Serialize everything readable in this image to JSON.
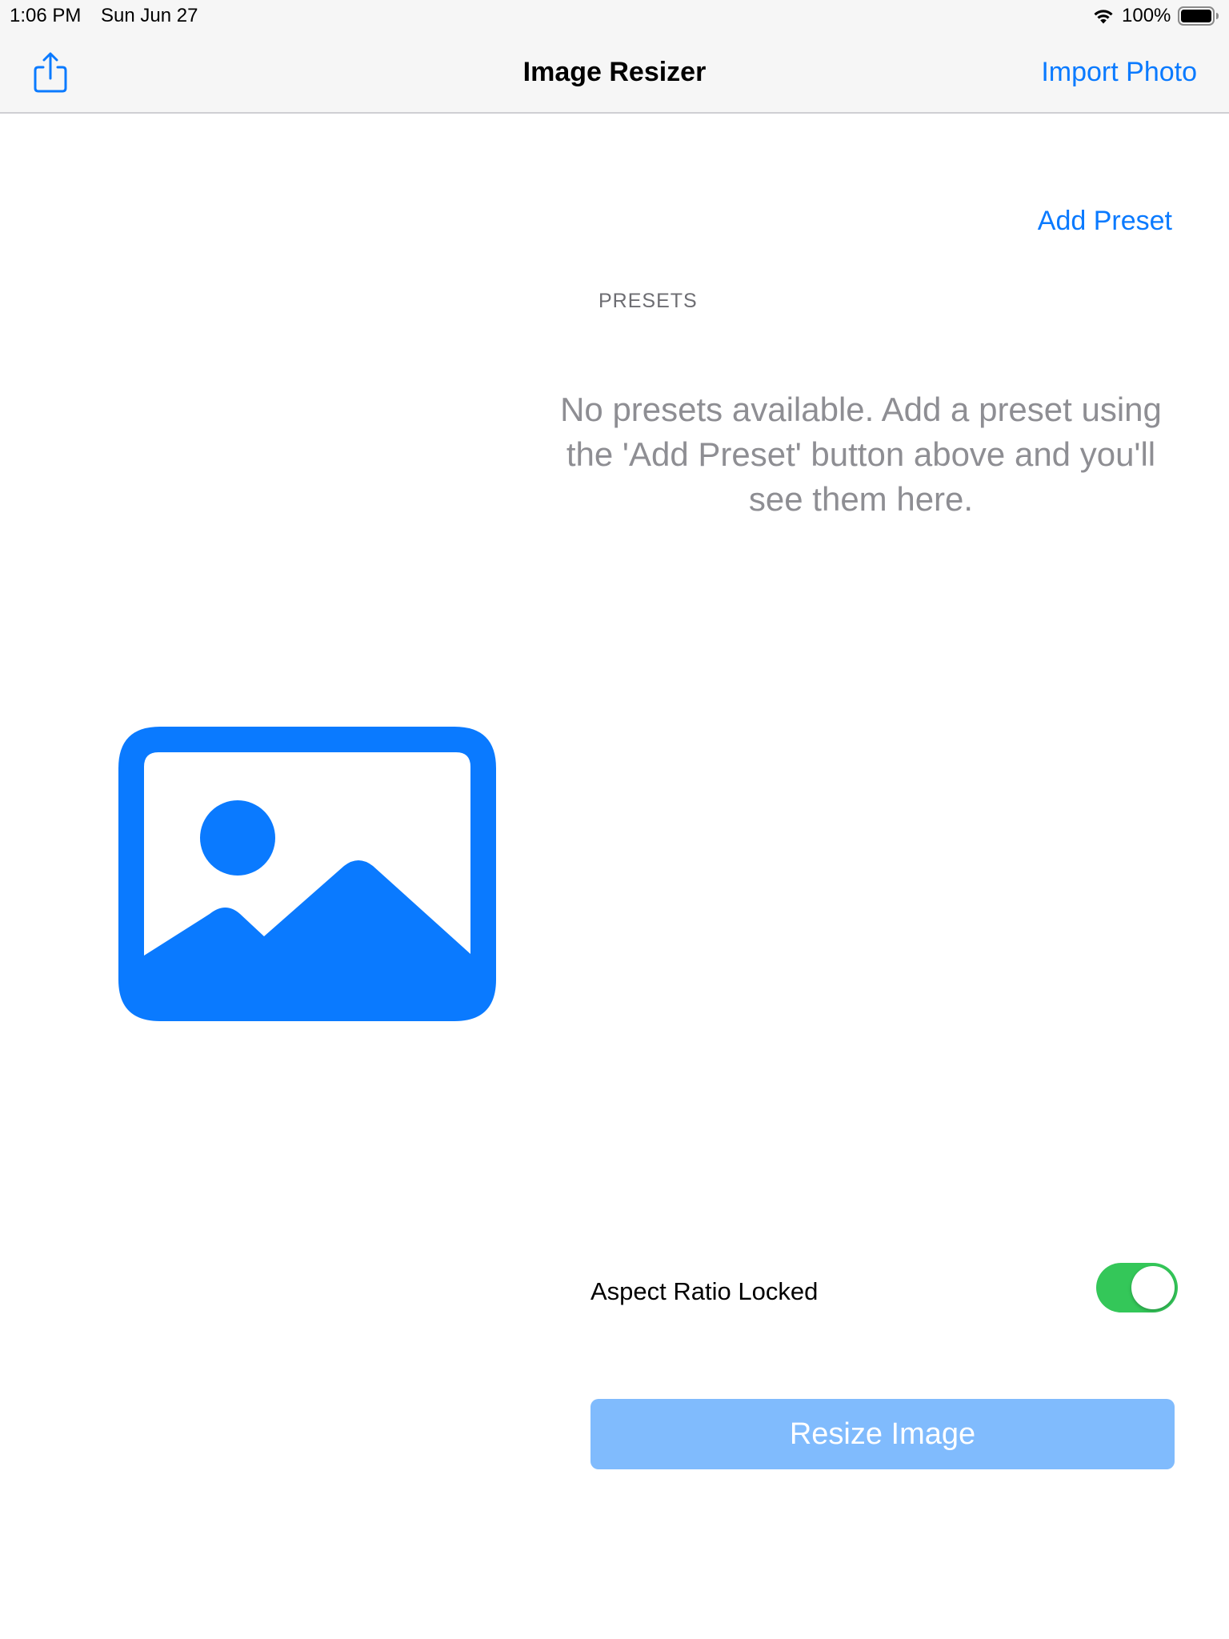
{
  "status_bar": {
    "time": "1:06 PM",
    "date": "Sun Jun 27",
    "battery": "100%",
    "icons": [
      "wifi-icon",
      "battery-icon"
    ]
  },
  "nav": {
    "title": "Image Resizer",
    "import_label": "Import Photo",
    "share_icon": "share-icon"
  },
  "presets": {
    "add_label": "Add Preset",
    "header": "PRESETS",
    "empty_message": "No presets available. Add a preset using the 'Add Preset' button above and you'll see them here."
  },
  "photo": {
    "icon": "photo-placeholder-icon"
  },
  "aspect": {
    "label": "Aspect Ratio Locked",
    "locked": true
  },
  "resize_button": {
    "label": "Resize Image"
  },
  "colors": {
    "accent": "#0a7aff",
    "toggle_on": "#34c759",
    "button_disabled": "#80bbfd",
    "secondary_text": "#8e8e93"
  }
}
